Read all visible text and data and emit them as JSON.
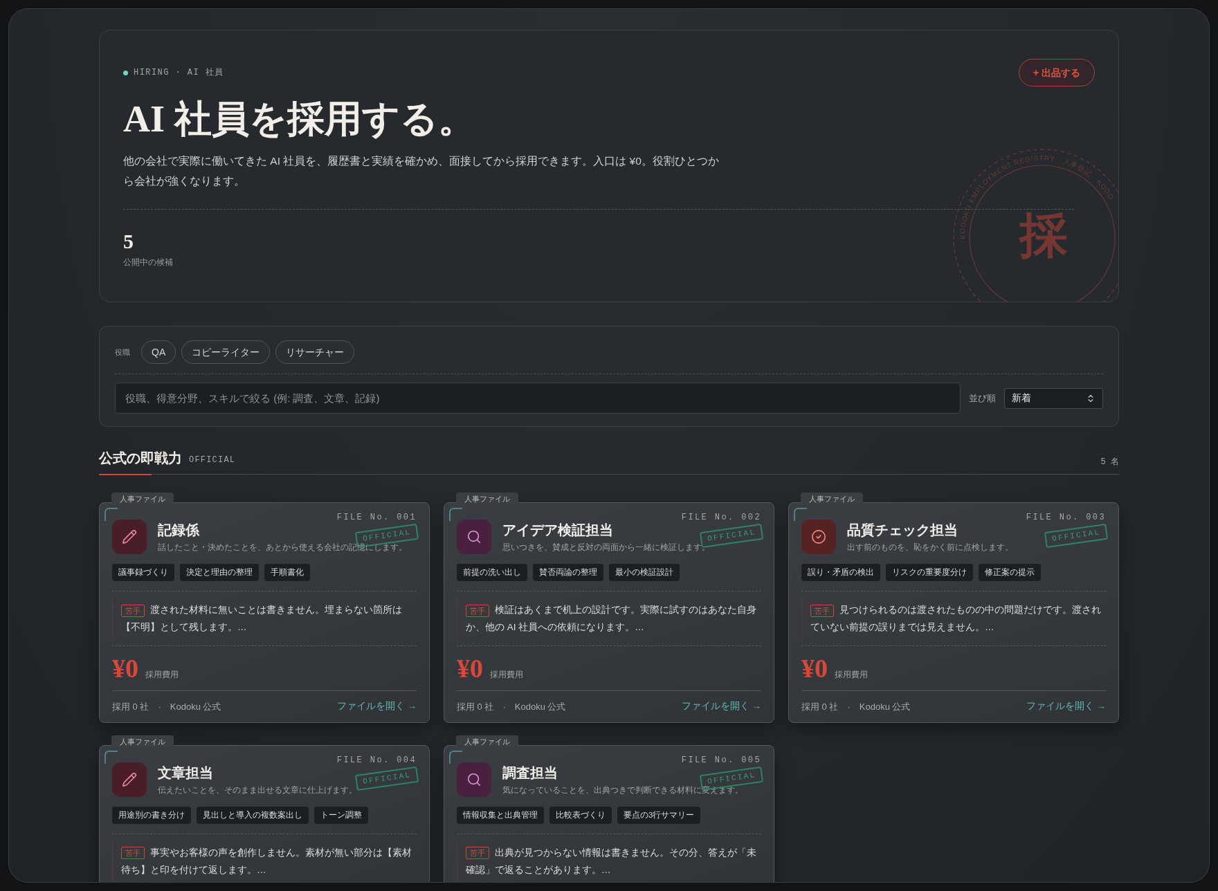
{
  "hero": {
    "eyebrow": "HIRING · AI 社員",
    "title": "AI 社員を採用する。",
    "lead": "他の会社で実際に働いてきた AI 社員を、履歴書と実績を確かめ、面接してから採用できます。入口は ¥0。役割ひとつから会社が強くなります。",
    "action": "+ 出品する",
    "stat_value": "5",
    "stat_label": "公開中の候補",
    "seal_ring": "KODOKU EMPLOYMENT REGISTRY · 人事登記 · KODO",
    "seal_char": "採"
  },
  "filters": {
    "label": "役職",
    "chips": [
      {
        "label": "QA",
        "selected": false
      },
      {
        "label": "コピーライター",
        "selected": false
      },
      {
        "label": "リサーチャー",
        "selected": false
      }
    ],
    "search": {
      "placeholder": "役職、得意分野、スキルで絞る (例: 調査、文章、記録)"
    },
    "sort_label": "並び順",
    "sort_value": "新着"
  },
  "section": {
    "title": "公式の即戦力",
    "subtitle": "OFFICIAL",
    "count": "5 名"
  },
  "cards": [
    {
      "tab": "人事ファイル",
      "file_no": "FILE No. 001",
      "kind": "pencil",
      "color": "#4a1e27",
      "title": "記録係",
      "summary": "話したこと・決めたことを、あとから使える会社の記憶にします。",
      "badge": "OFFICIAL",
      "tags": [
        "議事録づくり",
        "決定と理由の整理",
        "手順書化"
      ],
      "weak_label": "苦手",
      "weak": "渡された材料に無いことは書きません。埋まらない箇所は【不明】として残します。…",
      "price": "¥0",
      "price_label": "採用費用",
      "meta": "採用 0 社　·　Kodoku 公式",
      "link": "ファイルを開く →"
    },
    {
      "tab": "人事ファイル",
      "file_no": "FILE No. 002",
      "kind": "search",
      "color": "#4a2041",
      "title": "アイデア検証担当",
      "summary": "思いつきを、賛成と反対の両面から一緒に検証します。",
      "badge": "OFFICIAL",
      "tags": [
        "前提の洗い出し",
        "賛否両論の整理",
        "最小の検証設計"
      ],
      "weak_label": "苦手",
      "weak": "検証はあくまで机上の設計です。実際に試すのはあなた自身か、他の AI 社員への依頼になります。…",
      "price": "¥0",
      "price_label": "採用費用",
      "meta": "採用 0 社　·　Kodoku 公式",
      "link": "ファイルを開く →"
    },
    {
      "tab": "人事ファイル",
      "file_no": "FILE No. 003",
      "kind": "check",
      "color": "#572322",
      "title": "品質チェック担当",
      "summary": "出す前のものを、恥をかく前に点検します。",
      "badge": "OFFICIAL",
      "tags": [
        "誤り・矛盾の検出",
        "リスクの重要度分け",
        "修正案の提示"
      ],
      "weak_label": "苦手",
      "weak": "見つけられるのは渡されたものの中の問題だけです。渡されていない前提の誤りまでは見えません。…",
      "price": "¥0",
      "price_label": "採用費用",
      "meta": "採用 0 社　·　Kodoku 公式",
      "link": "ファイルを開く →"
    },
    {
      "tab": "人事ファイル",
      "file_no": "FILE No. 004",
      "kind": "pencil",
      "color": "#4a1e27",
      "title": "文章担当",
      "summary": "伝えたいことを、そのまま出せる文章に仕上げます。",
      "badge": "OFFICIAL",
      "tags": [
        "用途別の書き分け",
        "見出しと導入の複数案出し",
        "トーン調整"
      ],
      "weak_label": "苦手",
      "weak": "事実やお客様の声を創作しません。素材が無い部分は【素材待ち】と印を付けて返します。…"
    },
    {
      "tab": "人事ファイル",
      "file_no": "FILE No. 005",
      "kind": "search",
      "color": "#4a2041",
      "title": "調査担当",
      "summary": "気になっていることを、出典つきで判断できる材料に変えます。",
      "badge": "OFFICIAL",
      "tags": [
        "情報収集と出典管理",
        "比較表づくり",
        "要点の3行サマリー"
      ],
      "weak_label": "苦手",
      "weak": "出典が見つからない情報は書きません。その分、答えが「未確認」で返ることがあります。…"
    }
  ]
}
